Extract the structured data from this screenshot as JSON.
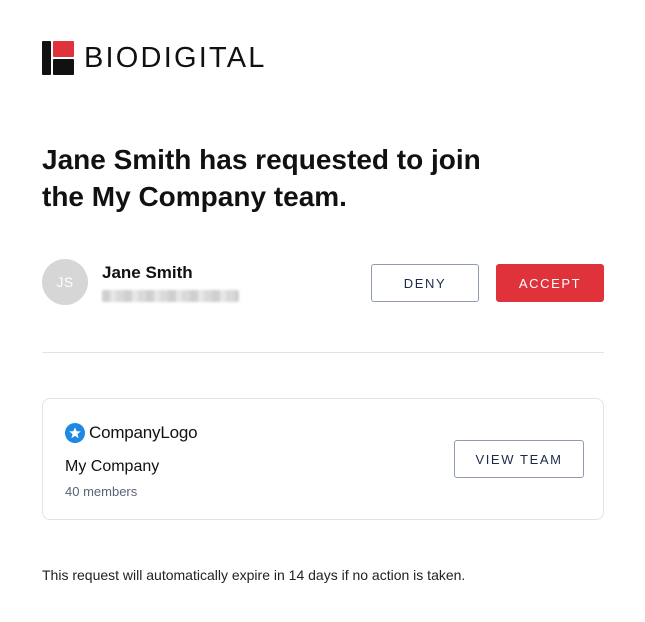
{
  "brand": {
    "name": "BIODIGITAL",
    "colors": {
      "dark": "#111111",
      "accent": "#e0323a"
    }
  },
  "headline": {
    "line1": "Jane Smith has requested to join",
    "line2": "the My Company team."
  },
  "requester": {
    "initials": "JS",
    "name": "Jane Smith",
    "email": ""
  },
  "actions": {
    "deny_label": "DENY",
    "accept_label": "ACCEPT"
  },
  "team": {
    "logo_text": "CompanyLogo",
    "logo_icon": "star-icon",
    "name": "My Company",
    "members": "40 members",
    "view_label": "VIEW TEAM",
    "colors": {
      "logo": "#1e88e5"
    }
  },
  "footer": {
    "note": "This request will automatically expire in 14 days if no action is taken."
  }
}
